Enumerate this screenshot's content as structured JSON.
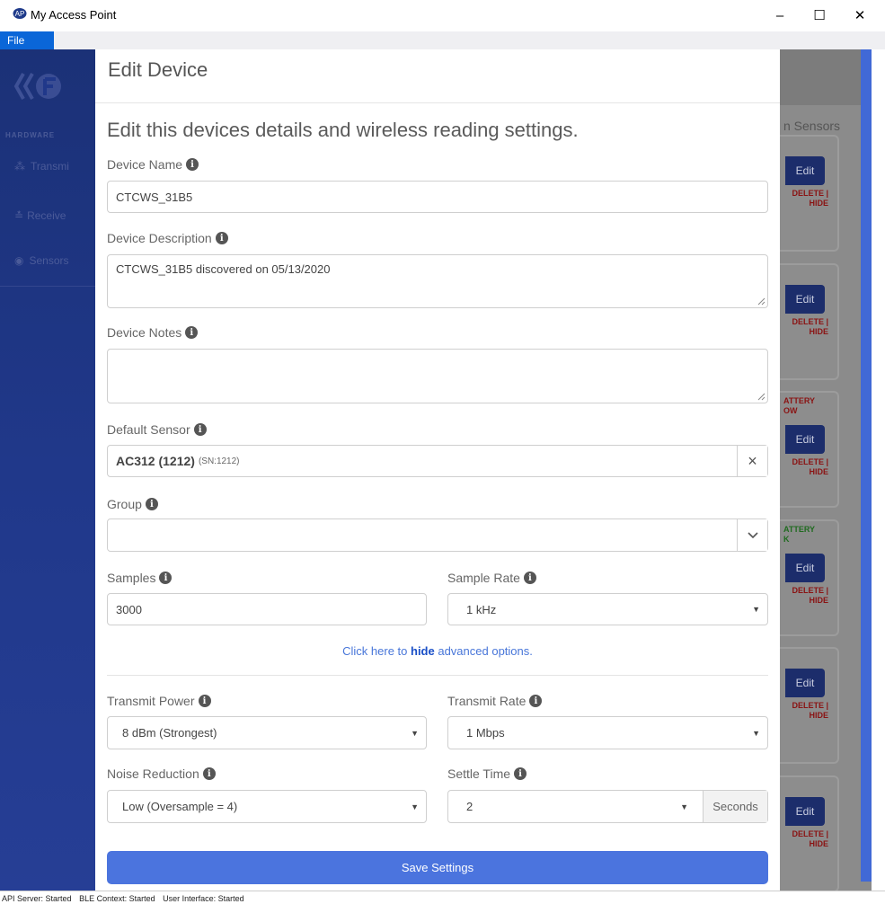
{
  "window": {
    "title": "My Access Point",
    "minimize_glyph": "–",
    "maximize_glyph": "☐",
    "close_glyph": "✕"
  },
  "menu": {
    "file": "File"
  },
  "background": {
    "section_label": "HARDWARE",
    "nav": [
      "Transmi",
      "Receive",
      "Sensors"
    ],
    "heading": "n Sensors",
    "cards": [
      {
        "battery": "",
        "edit": "Edit",
        "delete": "DELETE |",
        "hide": "HIDE"
      },
      {
        "battery": "",
        "edit": "Edit",
        "delete": "DELETE |",
        "hide": "HIDE"
      },
      {
        "battery": "ATTERY\nOW",
        "battery_color": "#8a1313",
        "edit": "Edit",
        "delete": "DELETE |",
        "hide": "HIDE"
      },
      {
        "battery": "ATTERY\nK",
        "battery_color": "#1f6b1f",
        "edit": "Edit",
        "delete": "DELETE |",
        "hide": "HIDE"
      },
      {
        "battery": "",
        "edit": "Edit",
        "delete": "DELETE |",
        "hide": "HIDE"
      },
      {
        "battery": "",
        "edit": "Edit",
        "delete": "DELETE |",
        "hide": "HIDE"
      }
    ]
  },
  "modal": {
    "title": "Edit Device",
    "subtitle": "Edit this devices details and wireless reading settings.",
    "device_name": {
      "label": "Device Name",
      "value": "CTCWS_31B5"
    },
    "device_description": {
      "label": "Device Description",
      "value": "CTCWS_31B5 discovered on 05/13/2020"
    },
    "device_notes": {
      "label": "Device Notes",
      "value": ""
    },
    "default_sensor": {
      "label": "Default Sensor",
      "value_bold": "AC312 (1212)",
      "value_small": "(SN:1212)",
      "clear": "×"
    },
    "group": {
      "label": "Group",
      "value": ""
    },
    "samples": {
      "label": "Samples",
      "value": "3000"
    },
    "sample_rate": {
      "label": "Sample Rate",
      "value": "1 kHz"
    },
    "advanced_link": {
      "prefix": "Click here to ",
      "bold": "hide",
      "suffix": " advanced options."
    },
    "transmit_power": {
      "label": "Transmit Power",
      "value": "8 dBm (Strongest)"
    },
    "transmit_rate": {
      "label": "Transmit Rate",
      "value": "1 Mbps"
    },
    "noise_reduction": {
      "label": "Noise Reduction",
      "value": "Low (Oversample = 4)"
    },
    "settle_time": {
      "label": "Settle Time",
      "value": "2",
      "unit": "Seconds"
    },
    "save_button": "Save Settings"
  },
  "status": [
    "API Server: Started",
    "BLE Context: Started",
    "User Interface: Started"
  ],
  "colors": {
    "accent": "#4b74de",
    "sidebar": "#20388a",
    "menu_file": "#0a66d8"
  }
}
